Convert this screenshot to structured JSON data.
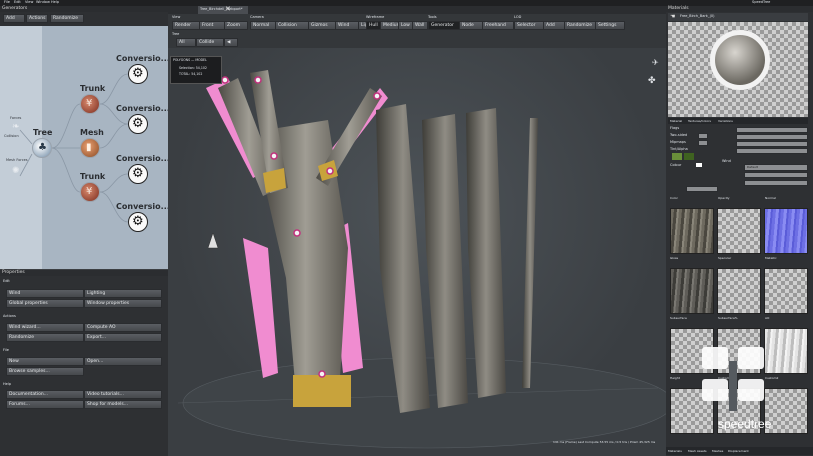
{
  "menu": {
    "items": [
      "File",
      "Edit",
      "View",
      "Window",
      "Help"
    ],
    "right_title": "SpeedTree"
  },
  "generators_panel": {
    "title": "Generators",
    "buttons": [
      "Add",
      "Actions",
      "Randomize"
    ]
  },
  "generator_graph": {
    "root_label": "Tree",
    "nodes": [
      {
        "label": "Trunk"
      },
      {
        "label": "Mesh"
      },
      {
        "label": "Trunk"
      }
    ],
    "conversions": [
      "Conversio...",
      "Conversio...",
      "Conversio...",
      "Conversio..."
    ],
    "side_labels": [
      "Forces",
      "Collision",
      "Mesh Forces"
    ]
  },
  "properties_panel": {
    "title": "Properties",
    "sections": [
      {
        "title": "Edit",
        "buttons": [
          "Wind",
          "Lighting",
          "Global properties",
          "Window properties"
        ]
      },
      {
        "title": "Actions",
        "buttons": [
          "Wind wizard...",
          "Compute AO",
          "Randomize",
          "Export..."
        ]
      },
      {
        "title": "File",
        "buttons": [
          "New",
          "Open...",
          "Browse samples..."
        ]
      },
      {
        "title": "Help",
        "buttons": [
          "Documentation...",
          "Video tutorials...",
          "Forums...",
          "Shop for models..."
        ]
      }
    ]
  },
  "document_tab": {
    "label": "Tree_Birchdell_Webport*"
  },
  "toolbar": {
    "groups": [
      {
        "label": "View",
        "buttons": [
          "Render",
          "Front",
          "Zoom"
        ]
      },
      {
        "label": "Camera",
        "buttons": [
          "Normal",
          "Collision",
          "Gizmos",
          "Wind",
          "Light"
        ]
      },
      {
        "label": "Wireframe",
        "buttons": [
          "Hull",
          "Medium",
          "Low",
          "Wall"
        ]
      },
      {
        "label": "Tools",
        "buttons": [
          "Generator",
          "Node",
          "Freehand"
        ]
      },
      {
        "label": "LOD",
        "buttons": [
          "Selector",
          "Add",
          "Randomize",
          "Settings"
        ]
      }
    ],
    "second_row": {
      "label": "Tree",
      "buttons": [
        "All",
        "Collide"
      ]
    }
  },
  "stats_overlay": {
    "title": "POLYGONS — MODEL",
    "rows": [
      "Selection: 54,102",
      "TOTAL: 54,102"
    ]
  },
  "viewport_status": "141 ms (Frame) Last Compute 53.55 ms / 0.5 tris / Prism 45,325 ms",
  "material_panel": {
    "title": "Materials",
    "tabs": [
      "Material",
      "Textures/Colors",
      "Variations"
    ],
    "preview_tab": "Free_Birch_Bark_(0)",
    "fields": [
      {
        "label": "Flags",
        "value": ""
      },
      {
        "label": "Two-sided",
        "value": "Ok"
      },
      {
        "label": "Mipmaps",
        "value": "Ok"
      },
      {
        "label": "Label",
        "value": ""
      }
    ],
    "tint_label": "Tint/Alpha",
    "color_label": "Colour",
    "wind_label": "Wind",
    "wind_value": "Default",
    "texture_slots": [
      "Color",
      "Opacity",
      "Normal",
      "Gloss",
      "Specular",
      "Metallic",
      "Subsurface",
      "Subsurface%",
      "AO",
      "Height",
      "Custom",
      "Custom2"
    ]
  },
  "bottom_tabs": [
    "Materials",
    "Mesh Assets",
    "Meshes",
    "Displacement"
  ],
  "watermark": "speedtree",
  "colors": {
    "accent_pink": "#f08cd0",
    "yellow_band": "#d9b43a",
    "panel_bg": "#2e3033",
    "graph_bg": "#a9b6c3"
  }
}
